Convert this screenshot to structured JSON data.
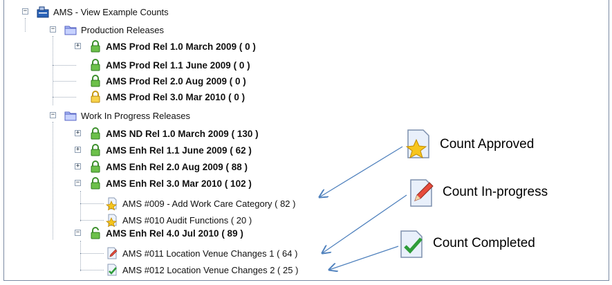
{
  "tree": {
    "root": {
      "label": "AMS - View Example Counts",
      "icon": "ams-folder-icon"
    },
    "groups": [
      {
        "label": "Production Releases",
        "icon": "folder-icon",
        "items": [
          {
            "label": "AMS Prod  Rel 1.0 March 2009 ( 0 )",
            "icon": "green-lock-icon",
            "expandable": true
          },
          {
            "label": "AMS Prod  Rel 1.1 June 2009 ( 0 )",
            "icon": "green-lock-icon",
            "expandable": false
          },
          {
            "label": "AMS Prod Rel 2.0 Aug 2009 ( 0 )",
            "icon": "green-lock-icon",
            "expandable": false
          },
          {
            "label": "AMS Prod Rel 3.0 Mar 2010 ( 0 )",
            "icon": "yellow-lock-icon",
            "expandable": false
          }
        ]
      },
      {
        "label": "Work In Progress Releases",
        "icon": "folder-icon",
        "items": [
          {
            "label": "AMS ND Rel 1.0 March 2009 ( 130 )",
            "icon": "green-lock-icon",
            "expandable": true
          },
          {
            "label": "AMS Enh Rel 1.1 June 2009 ( 62 )",
            "icon": "green-lock-icon",
            "expandable": true
          },
          {
            "label": "AMS Enh Rel 2.0 Aug 2009 ( 88 )",
            "icon": "green-lock-icon",
            "expandable": true
          },
          {
            "label": "AMS Enh Rel 3.0 Mar 2010 ( 102 )",
            "icon": "green-lock-icon",
            "expandable": true,
            "expanded": true,
            "children": [
              {
                "label": "AMS #009 - Add Work Care Category ( 82 )",
                "icon": "star-document-icon"
              },
              {
                "label": "AMS #010 Audit Functions ( 20 )",
                "icon": "star-document-icon"
              }
            ]
          },
          {
            "label": "AMS Enh Rel 4.0 Jul 2010 ( 89 )",
            "icon": "green-open-lock-icon",
            "expandable": true,
            "expanded": true,
            "children": [
              {
                "label": "AMS #011 Location Venue Changes 1 ( 64 )",
                "icon": "pencil-document-icon"
              },
              {
                "label": "AMS #012 Location Venue Changes 2 ( 25 )",
                "icon": "check-document-icon"
              }
            ]
          }
        ]
      }
    ]
  },
  "legend": [
    {
      "label": "Count Approved",
      "icon": "star-document-icon"
    },
    {
      "label": "Count In-progress",
      "icon": "pencil-document-icon"
    },
    {
      "label": "Count Completed",
      "icon": "check-document-icon"
    }
  ],
  "colors": {
    "arrow": "#4f81bd",
    "tree_line": "#9aa6b6",
    "panel_border": "#7a8aa3"
  }
}
